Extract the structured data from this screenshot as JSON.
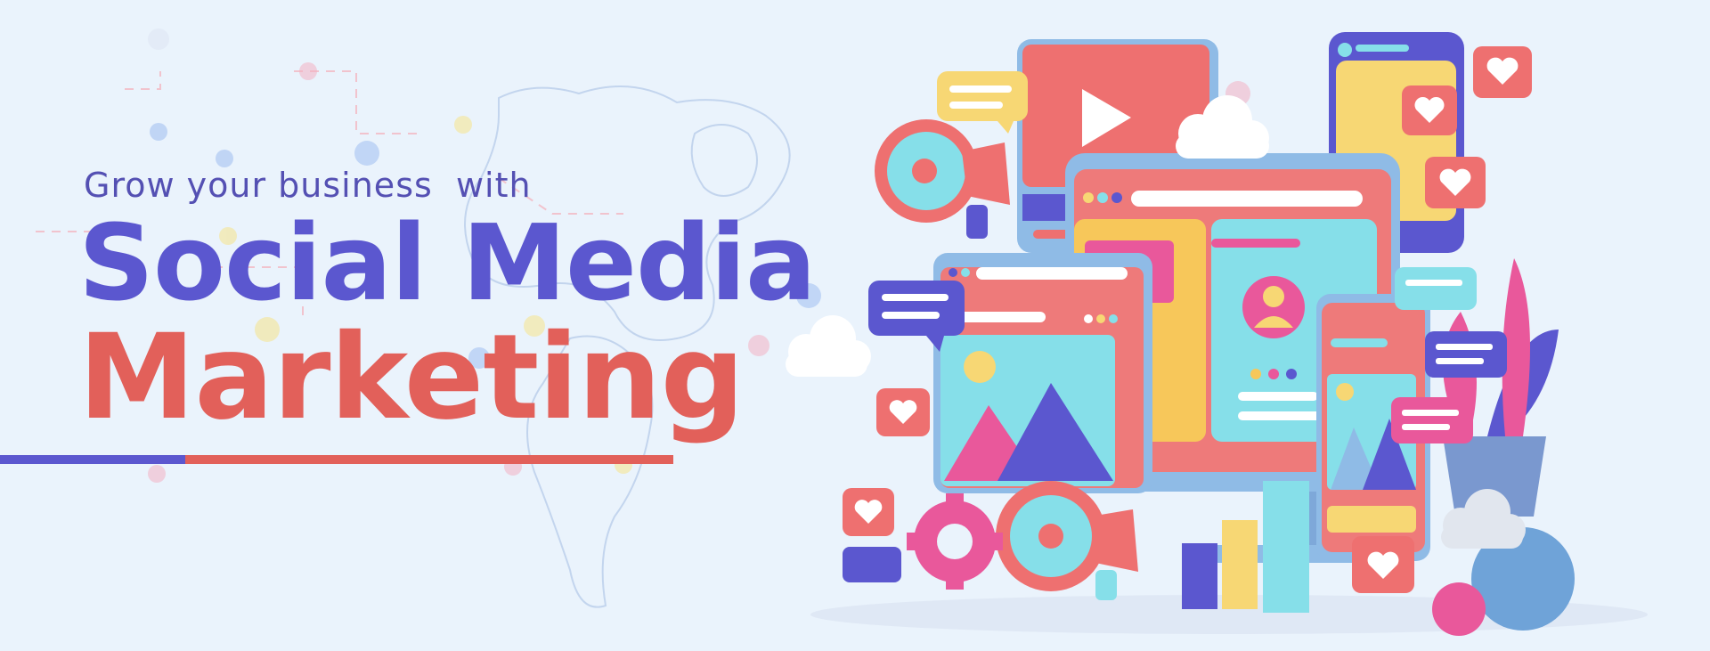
{
  "banner": {
    "tagline": "Grow your business  with",
    "title_line1": "Social Media",
    "title_line2": "Marketing"
  },
  "colors": {
    "background": "#eaf3fc",
    "primary_purple": "#5b57cf",
    "accent_red": "#e2605a",
    "tagline_color": "#5450b3",
    "cyan": "#86dfe9",
    "yellow": "#f7d774",
    "pink": "#e9589b",
    "light_blue": "#8fbbe6"
  },
  "illustration": {
    "icons": [
      "megaphone-icon",
      "heart-icon",
      "play-icon",
      "cloud-icon",
      "gear-icon",
      "chat-bubble-icon",
      "profile-icon",
      "image-icon",
      "bar-chart-icon",
      "plant-icon",
      "sphere-icon"
    ]
  }
}
